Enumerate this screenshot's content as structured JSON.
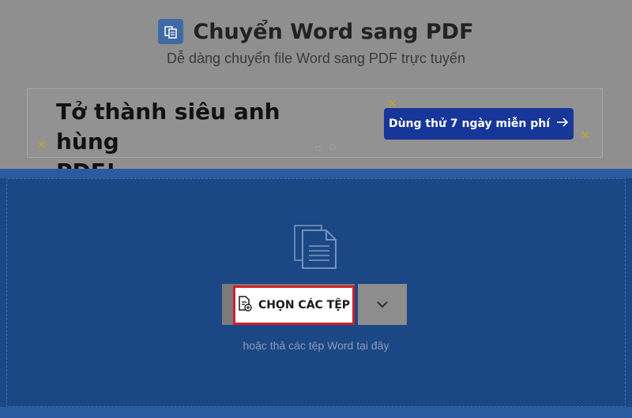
{
  "header": {
    "title": "Chuyển Word sang PDF",
    "subtitle": "Dễ dàng chuyển file Word sang PDF trực tuyến",
    "logo_icon": "document-copy-icon"
  },
  "promo": {
    "headline_line1": "Tở thành siêu anh hùng",
    "headline_line2": "PDF!",
    "cta_label": "Dùng thử 7 ngày miễn phí",
    "cta_icon": "arrow-right-icon",
    "cta_color": "#16369a",
    "sparkle_color": "#c6a41e"
  },
  "dropzone": {
    "background": "#1b4785",
    "file_icon": "stacked-files-icon",
    "choose_label": "CHỌN CÁC TỆP",
    "choose_icon": "file-add-icon",
    "dropdown_icon": "chevron-down-icon",
    "hint": "hoặc thả các tệp Word tại đây",
    "highlight_color": "#d0202a"
  }
}
